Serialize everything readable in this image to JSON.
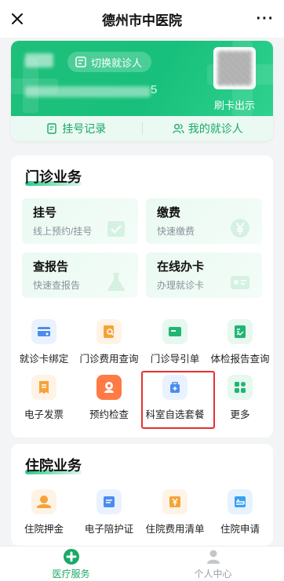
{
  "nav": {
    "title": "德州市中医院",
    "more": "···"
  },
  "patient_card": {
    "switch_label": "切换就诊人",
    "id_tail": "5",
    "card_label": "刷卡出示",
    "links": [
      {
        "label": "挂号记录",
        "icon": "document-icon"
      },
      {
        "label": "我的就诊人",
        "icon": "people-icon"
      }
    ]
  },
  "outpatient": {
    "title": "门诊业务",
    "tiles": [
      {
        "title": "挂号",
        "sub": "线上预约/挂号"
      },
      {
        "title": "缴费",
        "sub": "快速缴费"
      },
      {
        "title": "查报告",
        "sub": "快速查报告"
      },
      {
        "title": "在线办卡",
        "sub": "办理就诊卡"
      }
    ],
    "grid": [
      {
        "label": "就诊卡绑定",
        "icon": "card-bind-icon"
      },
      {
        "label": "门诊费用查询",
        "icon": "fee-query-icon"
      },
      {
        "label": "门诊导引单",
        "icon": "guide-icon"
      },
      {
        "label": "体检报告查询",
        "icon": "checkup-report-icon"
      },
      {
        "label": "电子发票",
        "icon": "invoice-icon"
      },
      {
        "label": "预约检查",
        "icon": "appointment-icon"
      },
      {
        "label": "科室自选套餐",
        "icon": "package-icon"
      },
      {
        "label": "更多",
        "icon": "more-grid-icon"
      }
    ]
  },
  "inpatient": {
    "title": "住院业务",
    "grid": [
      {
        "label": "住院押金",
        "icon": "deposit-icon"
      },
      {
        "label": "电子陪护证",
        "icon": "escort-pass-icon"
      },
      {
        "label": "住院费用清单",
        "icon": "fee-list-icon"
      },
      {
        "label": "住院申请",
        "icon": "bed-icon"
      }
    ]
  },
  "tabbar": [
    {
      "label": "医疗服务",
      "active": true
    },
    {
      "label": "个人中心",
      "active": false
    }
  ],
  "colors": {
    "brand_green": "#1aa968",
    "highlight_red": "#e53030"
  }
}
